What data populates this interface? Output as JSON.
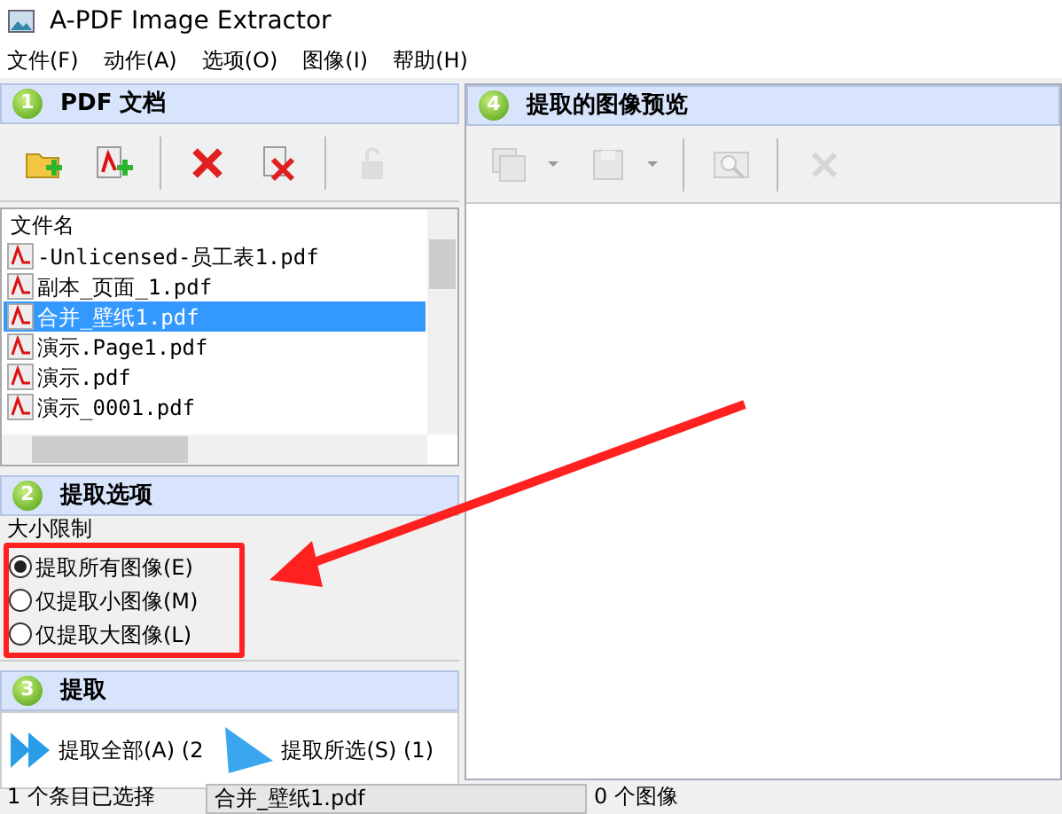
{
  "window": {
    "title": "A-PDF Image Extractor"
  },
  "menu": [
    "文件(F)",
    "动作(A)",
    "选项(O)",
    "图像(I)",
    "帮助(H)"
  ],
  "documents_panel": {
    "number": "1",
    "title": "PDF 文档",
    "toolbar": [
      {
        "kind": "add-folder",
        "disabled": false
      },
      {
        "kind": "add-pdf",
        "disabled": false
      },
      {
        "kind": "remove",
        "disabled": false
      },
      {
        "kind": "remove-all",
        "disabled": false
      },
      {
        "kind": "lock",
        "disabled": true
      }
    ],
    "list_header": "文件名",
    "files": [
      {
        "name": "-Unlicensed-员工表1.pdf",
        "selected": false
      },
      {
        "name": "副本_页面_1.pdf",
        "selected": false
      },
      {
        "name": "合并_壁纸1.pdf",
        "selected": true
      },
      {
        "name": "演示.Page1.pdf",
        "selected": false
      },
      {
        "name": "演示.pdf",
        "selected": false
      },
      {
        "name": "演示_0001.pdf",
        "selected": false
      }
    ]
  },
  "options_panel": {
    "number": "2",
    "title": "提取选项",
    "group": "大小限制",
    "options": [
      {
        "label": "提取所有图像(E)",
        "selected": true
      },
      {
        "label": "仅提取小图像(M)",
        "selected": false
      },
      {
        "label": "仅提取大图像(L)",
        "selected": false
      }
    ]
  },
  "extract_panel": {
    "number": "3",
    "title": "提取",
    "buttons": [
      {
        "kind": "all",
        "label": "提取全部(A)",
        "count": "(2"
      },
      {
        "kind": "selected",
        "label": "提取所选(S)",
        "count": "(1)"
      }
    ]
  },
  "preview_panel": {
    "number": "4",
    "title": "提取的图像预览",
    "toolbar": [
      {
        "kind": "save-all",
        "disabled": true,
        "dropdown": true
      },
      {
        "kind": "save",
        "disabled": true,
        "dropdown": true
      },
      {
        "kind": "zoom",
        "disabled": true,
        "dropdown": false
      },
      {
        "kind": "delete",
        "disabled": true,
        "dropdown": false
      }
    ]
  },
  "status_bar": [
    "1 个条目已选择",
    "合并_壁纸1.pdf",
    "0 个图像"
  ]
}
